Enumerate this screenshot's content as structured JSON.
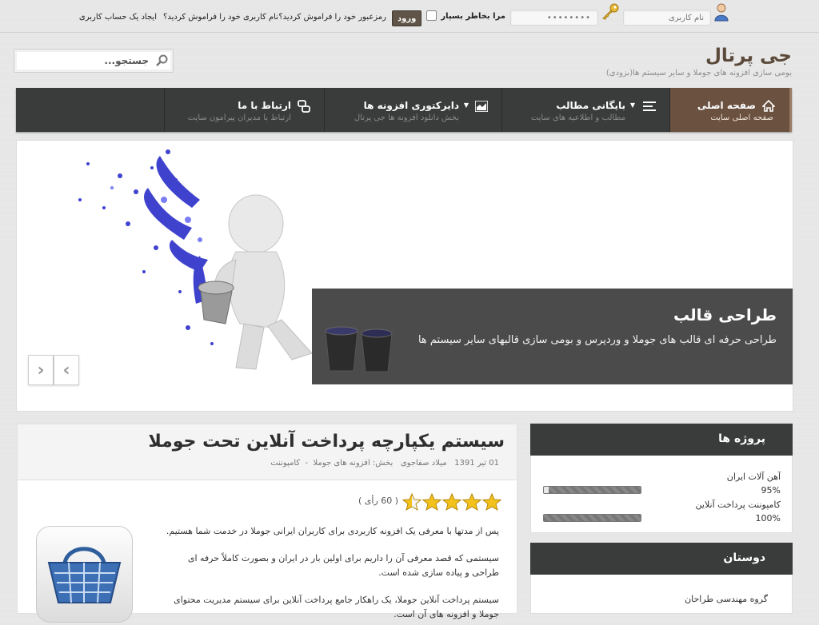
{
  "login": {
    "username_placeholder": "نام کاربری",
    "password_value": "••••••••",
    "remember_label": "مرا بخاطر بسپار",
    "login_button": "ورود",
    "forgot_password": "رمزعبور خود را فراموش کردید؟",
    "forgot_username": "نام کاربری خود را فراموش کردید؟",
    "register": "ایجاد یک حساب کاربری"
  },
  "brand": {
    "title": "جی پرتال",
    "subtitle": "بومی سازی افزونه های جوملا و سایر سیستم ها(بزودی)"
  },
  "search": {
    "placeholder": "جستجو..."
  },
  "nav": [
    {
      "label": "صفحه اصلی",
      "sub": "صفحه اصلی سایت",
      "icon": "home-icon",
      "active": true
    },
    {
      "label": "بایگانی مطالب",
      "sub": "مطالب و اطلاعیه های سایت",
      "icon": "list-icon",
      "active": false
    },
    {
      "label": "دایرکتوری افزونه ها",
      "sub": "بخش دانلود افزونه ها جی پرتال",
      "icon": "chart-icon",
      "active": false
    },
    {
      "label": "ارتباط با ما",
      "sub": "ارتباط با مدیران پیرامون سایت",
      "icon": "link-icon",
      "active": false
    }
  ],
  "slider": {
    "caption_title": "طراحی قالب",
    "caption_text": "طراحی حرفه ای قالب های جوملا و وردپرس و بومی سازی قالبهای سایر سیستم ها"
  },
  "article": {
    "title": "سیستم یکپارچه پرداخت آنلاین تحت جوملا",
    "date": "01 تیر 1391",
    "author": "میلاد صفاجوی",
    "section_label": "بخش:",
    "section": "افزونه های جوملا",
    "separator": "-",
    "category": "کامپوننت",
    "rating": 4.5,
    "votes": "( 60 رأی )",
    "paragraphs": [
      "پس از مدتها با معرفی یک افزونه کاربردی برای کاربران ایرانی جوملا در خدمت شما هستیم.",
      "سیستمی که قصد معرفی آن را داریم برای اولین بار در ایران و بصورت کاملاً حرفه ای",
      "طراحی و پیاده سازی شده است.",
      "سیستم پرداخت آنلاین جوملا، یک راهکار جامع پرداخت آنلاین برای سیستم مدیریت محتوای",
      "جوملا و افزونه های آن است."
    ]
  },
  "projects": {
    "title": "پروژه ها",
    "items": [
      {
        "name": "آهن آلات ایران",
        "percent_label": "95%",
        "progress": 0.95
      },
      {
        "name": "کامپوننت پرداخت آنلاین",
        "percent_label": "100%",
        "progress": 1.0
      }
    ]
  },
  "friends": {
    "title": "دوستان",
    "items": [
      "گروه مهندسی طراحان"
    ]
  },
  "colors": {
    "nav_bg": "#3a3b3b",
    "nav_active": "#6a5140",
    "brand": "#5b4a3a"
  }
}
